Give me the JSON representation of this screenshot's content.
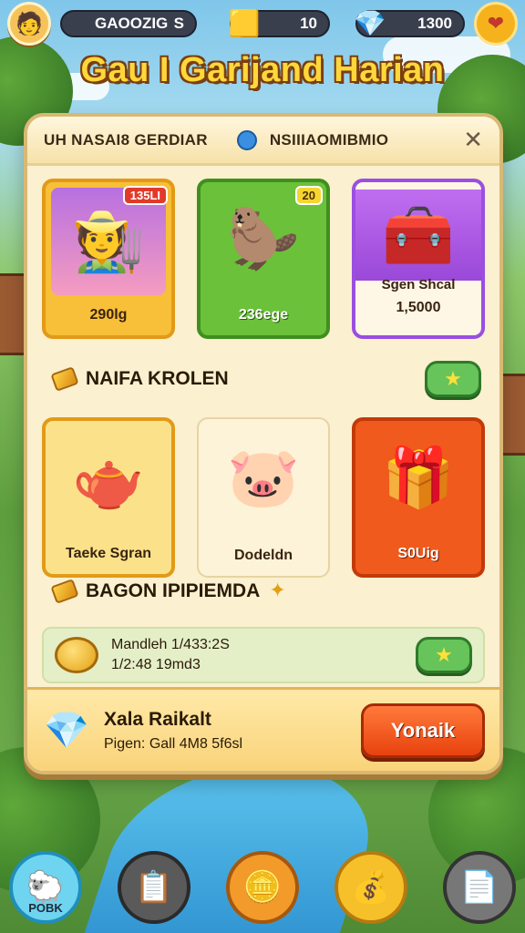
{
  "topbar": {
    "player_name": "GAOOZIG",
    "player_level": "S",
    "gold": "10",
    "gems": "1300"
  },
  "title": "Gau I Garijand Harian",
  "panel": {
    "tab_left": "UH NASAI8 GERDIAR",
    "tab_right": "NSIIIAOMIBMIO",
    "close": "✕",
    "cards_top": [
      {
        "label": "290lg",
        "badge": "135LI"
      },
      {
        "label": "236ege",
        "badge": "20"
      },
      {
        "label": "1,5000",
        "sub": "Sgen Shcal"
      }
    ],
    "section1_title": "NAIFA KROLEN",
    "cards_mid": [
      {
        "label": "Taeke Sgran"
      },
      {
        "label": "Dodeldn"
      },
      {
        "label": "S0Uig"
      }
    ],
    "section2_title": "BAGON IPIPIEMDA",
    "reward": {
      "line1": "Mandleh 1/433:2S",
      "line2": "1/2:48 19md3"
    },
    "footer": {
      "title": "Xala Raikalt",
      "subtitle": "Pigen: Gall 4M8 5f6sl",
      "button": "Yonaik"
    }
  },
  "nav": {
    "first_label": "POBK"
  }
}
